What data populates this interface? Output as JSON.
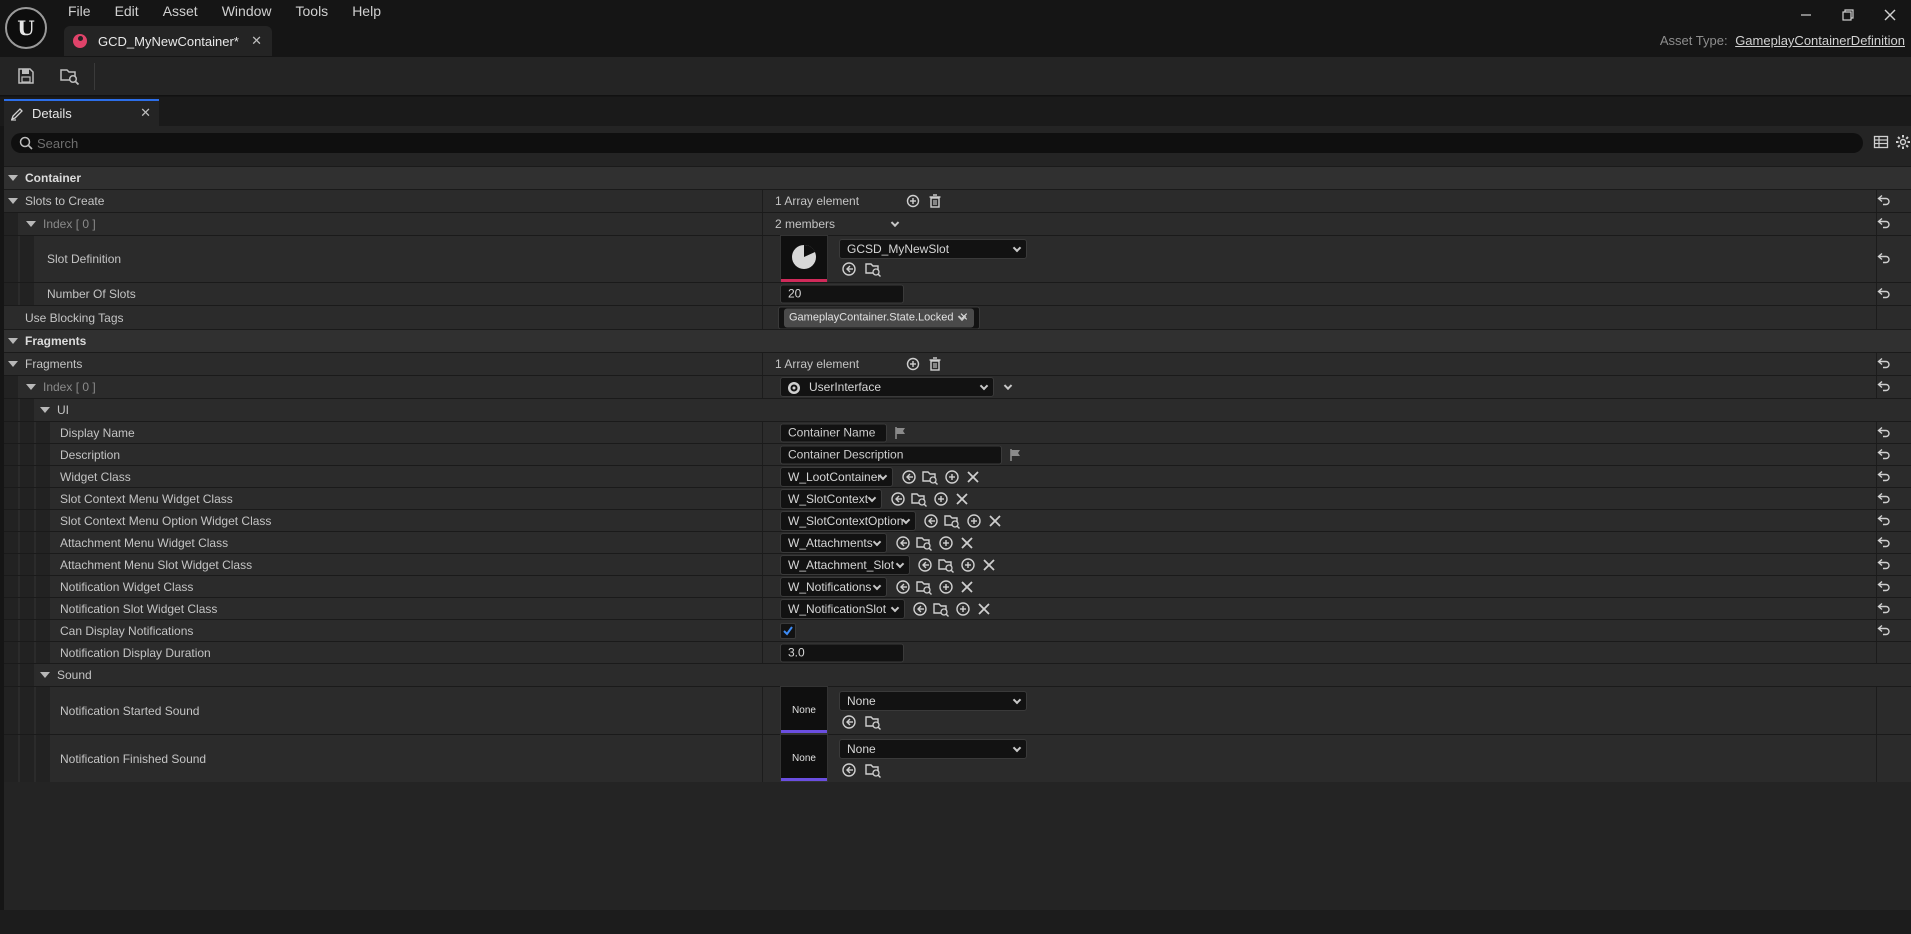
{
  "menu": [
    "File",
    "Edit",
    "Asset",
    "Window",
    "Tools",
    "Help"
  ],
  "tab": {
    "title": "GCD_MyNewContainer*"
  },
  "asset_type": {
    "label": "Asset Type:",
    "value": "GameplayContainerDefinition"
  },
  "details": {
    "tab_label": "Details",
    "search_placeholder": "Search"
  },
  "rows": {
    "container": "Container",
    "slots_to_create": "Slots to Create",
    "slots_array": "1 Array element",
    "index0": "Index [ 0 ]",
    "members": "2 members",
    "slot_definition": "Slot Definition",
    "slot_definition_value": "GCSD_MyNewSlot",
    "number_of_slots": "Number Of Slots",
    "number_of_slots_value": "20",
    "use_blocking_tags": "Use Blocking Tags",
    "blocking_tag": "GameplayContainer.State.Locked",
    "fragments_cat": "Fragments",
    "fragments": "Fragments",
    "fragments_array": "1 Array element",
    "fragment_index0": "Index [ 0 ]",
    "fragment_type": "UserInterface",
    "ui": "UI",
    "display_name": "Display Name",
    "display_name_value": "Container Name",
    "description": "Description",
    "description_value": "Container Description",
    "widget_class": "Widget Class",
    "widget_class_value": "W_LootContainer",
    "slot_ctx_menu": "Slot Context Menu Widget Class",
    "slot_ctx_menu_value": "W_SlotContext",
    "slot_ctx_option": "Slot Context Menu Option Widget Class",
    "slot_ctx_option_value": "W_SlotContextOption",
    "attach_menu": "Attachment Menu Widget Class",
    "attach_menu_value": "W_Attachments",
    "attach_slot": "Attachment Menu Slot Widget Class",
    "attach_slot_value": "W_Attachment_Slot",
    "notif_widget": "Notification Widget Class",
    "notif_widget_value": "W_Notifications",
    "notif_slot": "Notification Slot Widget Class",
    "notif_slot_value": "W_NotificationSlot",
    "can_display": "Can Display Notifications",
    "can_display_value": true,
    "notif_duration": "Notification Display Duration",
    "notif_duration_value": "3.0",
    "sound": "Sound",
    "notif_started": "Notification Started Sound",
    "notif_started_value": "None",
    "notif_finished": "Notification Finished Sound",
    "notif_finished_value": "None",
    "thumb_none": "None"
  },
  "colors": {
    "accent": "#2c6ee8",
    "tab_icon": "#e0436a",
    "slot_thumb_bar": "#d02a5a",
    "sound_thumb_bar": "#6a4ee0",
    "check": "#3d8bf5"
  },
  "icons": {
    "window": [
      "minimize-icon",
      "restore-icon",
      "close-icon"
    ],
    "toolbar": [
      "save-icon",
      "browse-asset-icon"
    ],
    "row": [
      "add-element-icon",
      "delete-icon",
      "use-selected-icon",
      "browse-icon",
      "create-new-icon",
      "clear-icon",
      "reset-to-default-icon",
      "localize-flag-icon"
    ]
  }
}
